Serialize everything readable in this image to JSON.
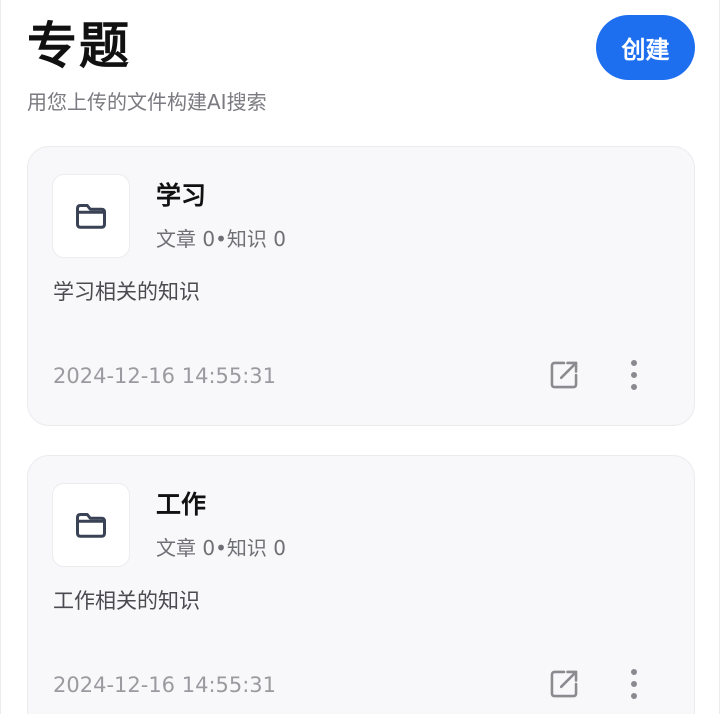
{
  "header": {
    "title": "专题",
    "subtitle": "用您上传的文件构建AI搜索",
    "create_label": "创建"
  },
  "topics": [
    {
      "name": "学习",
      "stats": "文章 0•知识 0",
      "description": "学习相关的知识",
      "timestamp": "2024-12-16 14:55:31"
    },
    {
      "name": "工作",
      "stats": "文章 0•知识 0",
      "description": "工作相关的知识",
      "timestamp": "2024-12-16 14:55:31"
    }
  ],
  "icons": {
    "folder": "folder-icon",
    "share": "share-icon",
    "more": "more-vertical-icon"
  },
  "colors": {
    "accent": "#1e6ff0",
    "card_background": "#f8f8fa",
    "icon_dark": "#3a4255",
    "icon_gray": "#8a8a90"
  }
}
